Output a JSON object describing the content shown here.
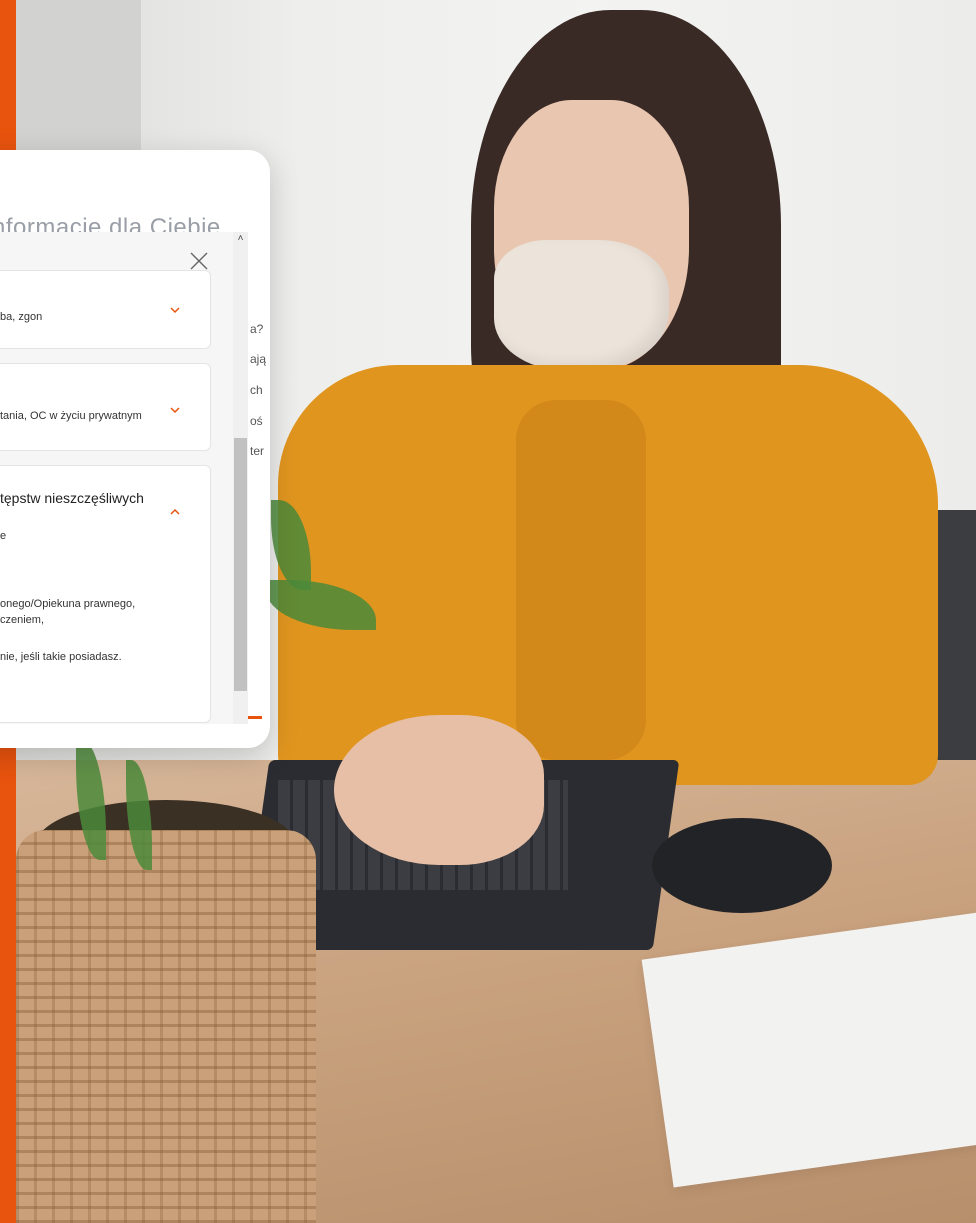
{
  "brand": {
    "accent": "#e8530e"
  },
  "popup": {
    "header_text": "nformacje dla Ciebie",
    "close_icon": "close-icon",
    "scroll_up_glyph": "˄",
    "accordions": [
      {
        "subtitle": "ba, zgon",
        "expanded": false,
        "chevron": "chevron-down-icon"
      },
      {
        "subtitle": "tania, OC w życiu prywatnym",
        "expanded": false,
        "chevron": "chevron-down-icon"
      },
      {
        "title": "tępstw nieszczęśliwych",
        "subtitle": "e",
        "expanded": true,
        "chevron": "chevron-up-icon",
        "content": [
          "onego/Opiekuna prawnego,",
          "czeniem,",
          "nie, jeśli takie posiadasz."
        ]
      }
    ],
    "right_strip": [
      "a?",
      "ają",
      "ch",
      "oś",
      "ter"
    ]
  }
}
